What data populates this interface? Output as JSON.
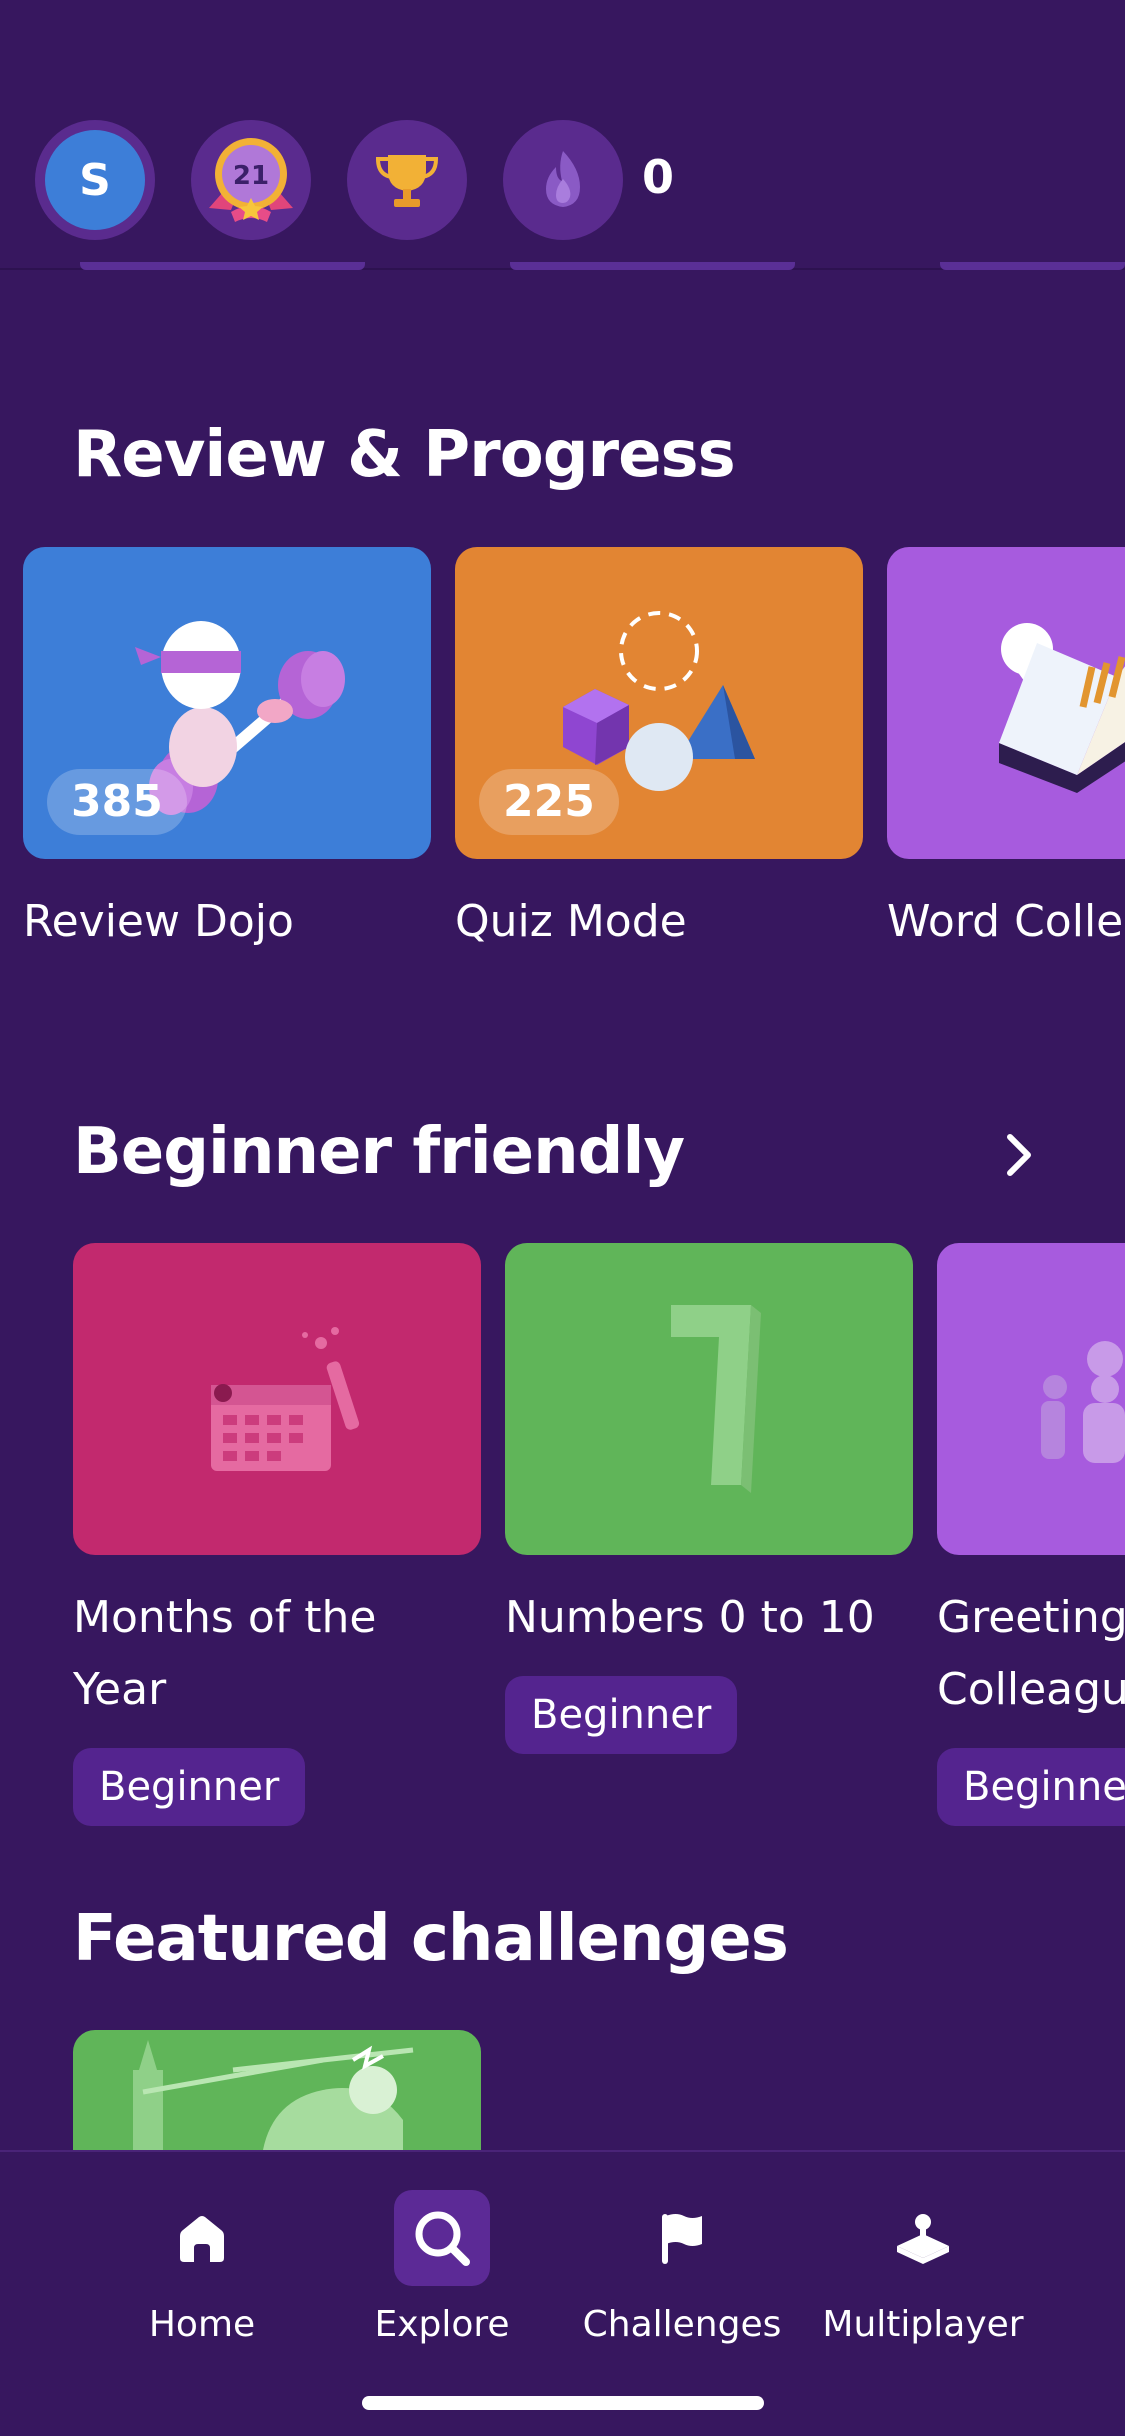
{
  "header": {
    "avatar_letter": "S",
    "level_badge": "21",
    "streak_count": "0",
    "icons": [
      "avatar",
      "level-medal-icon",
      "trophy-icon",
      "flame-icon"
    ]
  },
  "review": {
    "title": "Review & Progress",
    "cards": [
      {
        "label": "Review Dojo",
        "count": "385",
        "color": "#3d7ed8"
      },
      {
        "label": "Quiz Mode",
        "count": "225",
        "color": "#e28533"
      },
      {
        "label": "Word Colle",
        "color": "#a75bde"
      }
    ]
  },
  "beginner": {
    "title": "Beginner friendly",
    "cards": [
      {
        "label_line1": "Months of the",
        "label_line2": "Year",
        "level": "Beginner",
        "color": "#c2296e"
      },
      {
        "label_line1": "Numbers 0 to 10",
        "label_line2": "",
        "level": "Beginner",
        "color": "#60b559"
      },
      {
        "label_line1": "Greeting",
        "label_line2": "Colleagu",
        "level": "Beginner",
        "color": "#a75bde"
      }
    ]
  },
  "featured": {
    "title": "Featured challenges",
    "card_color": "#60b559"
  },
  "nav": {
    "items": [
      {
        "label": "Home",
        "icon": "home-icon"
      },
      {
        "label": "Explore",
        "icon": "search-icon",
        "active": true
      },
      {
        "label": "Challenges",
        "icon": "flag-icon"
      },
      {
        "label": "Multiplayer",
        "icon": "joystick-icon"
      }
    ],
    "active_color": "#5c2a96"
  }
}
